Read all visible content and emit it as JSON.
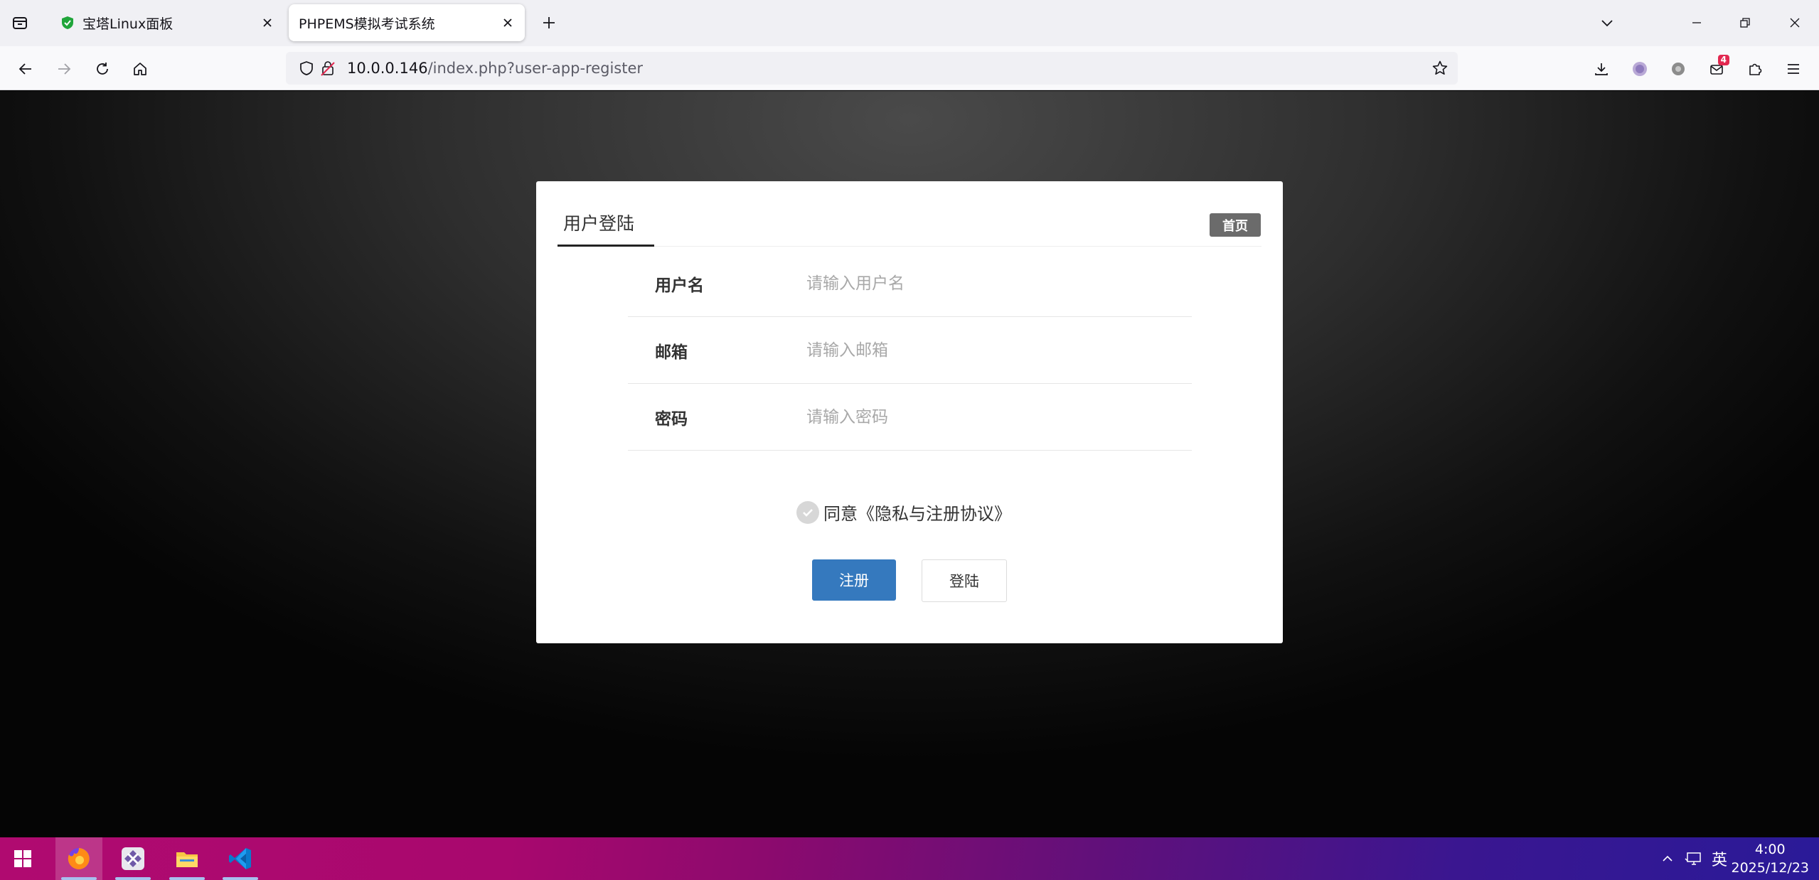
{
  "browser": {
    "tabs": [
      {
        "title": "宝塔Linux面板",
        "active": false,
        "favicon": "shield-favicon"
      },
      {
        "title": "PHPEMS模拟考试系统",
        "active": true
      }
    ],
    "url": {
      "host": "10.0.0.146",
      "path": "/index.php?user-app-register"
    },
    "toolbar_badge_count": "4",
    "accent_color": "#e22850"
  },
  "page": {
    "tab_label": "用户登陆",
    "home_link": "首页",
    "fields": [
      {
        "label": "用户名",
        "placeholder": "请输入用户名"
      },
      {
        "label": "邮箱",
        "placeholder": "请输入邮箱"
      },
      {
        "label": "密码",
        "placeholder": "请输入密码"
      }
    ],
    "agreement": "同意《隐私与注册协议》",
    "register_button": "注册",
    "login_button": "登陆",
    "primary_color": "#3579be"
  },
  "taskbar": {
    "apps": [
      "start-icon",
      "firefox-icon",
      "app-x-icon",
      "file-explorer-icon",
      "vscode-icon"
    ],
    "tray": {
      "language": "英"
    },
    "clock": {
      "time": "4:00",
      "date": "2025/12/23"
    }
  }
}
